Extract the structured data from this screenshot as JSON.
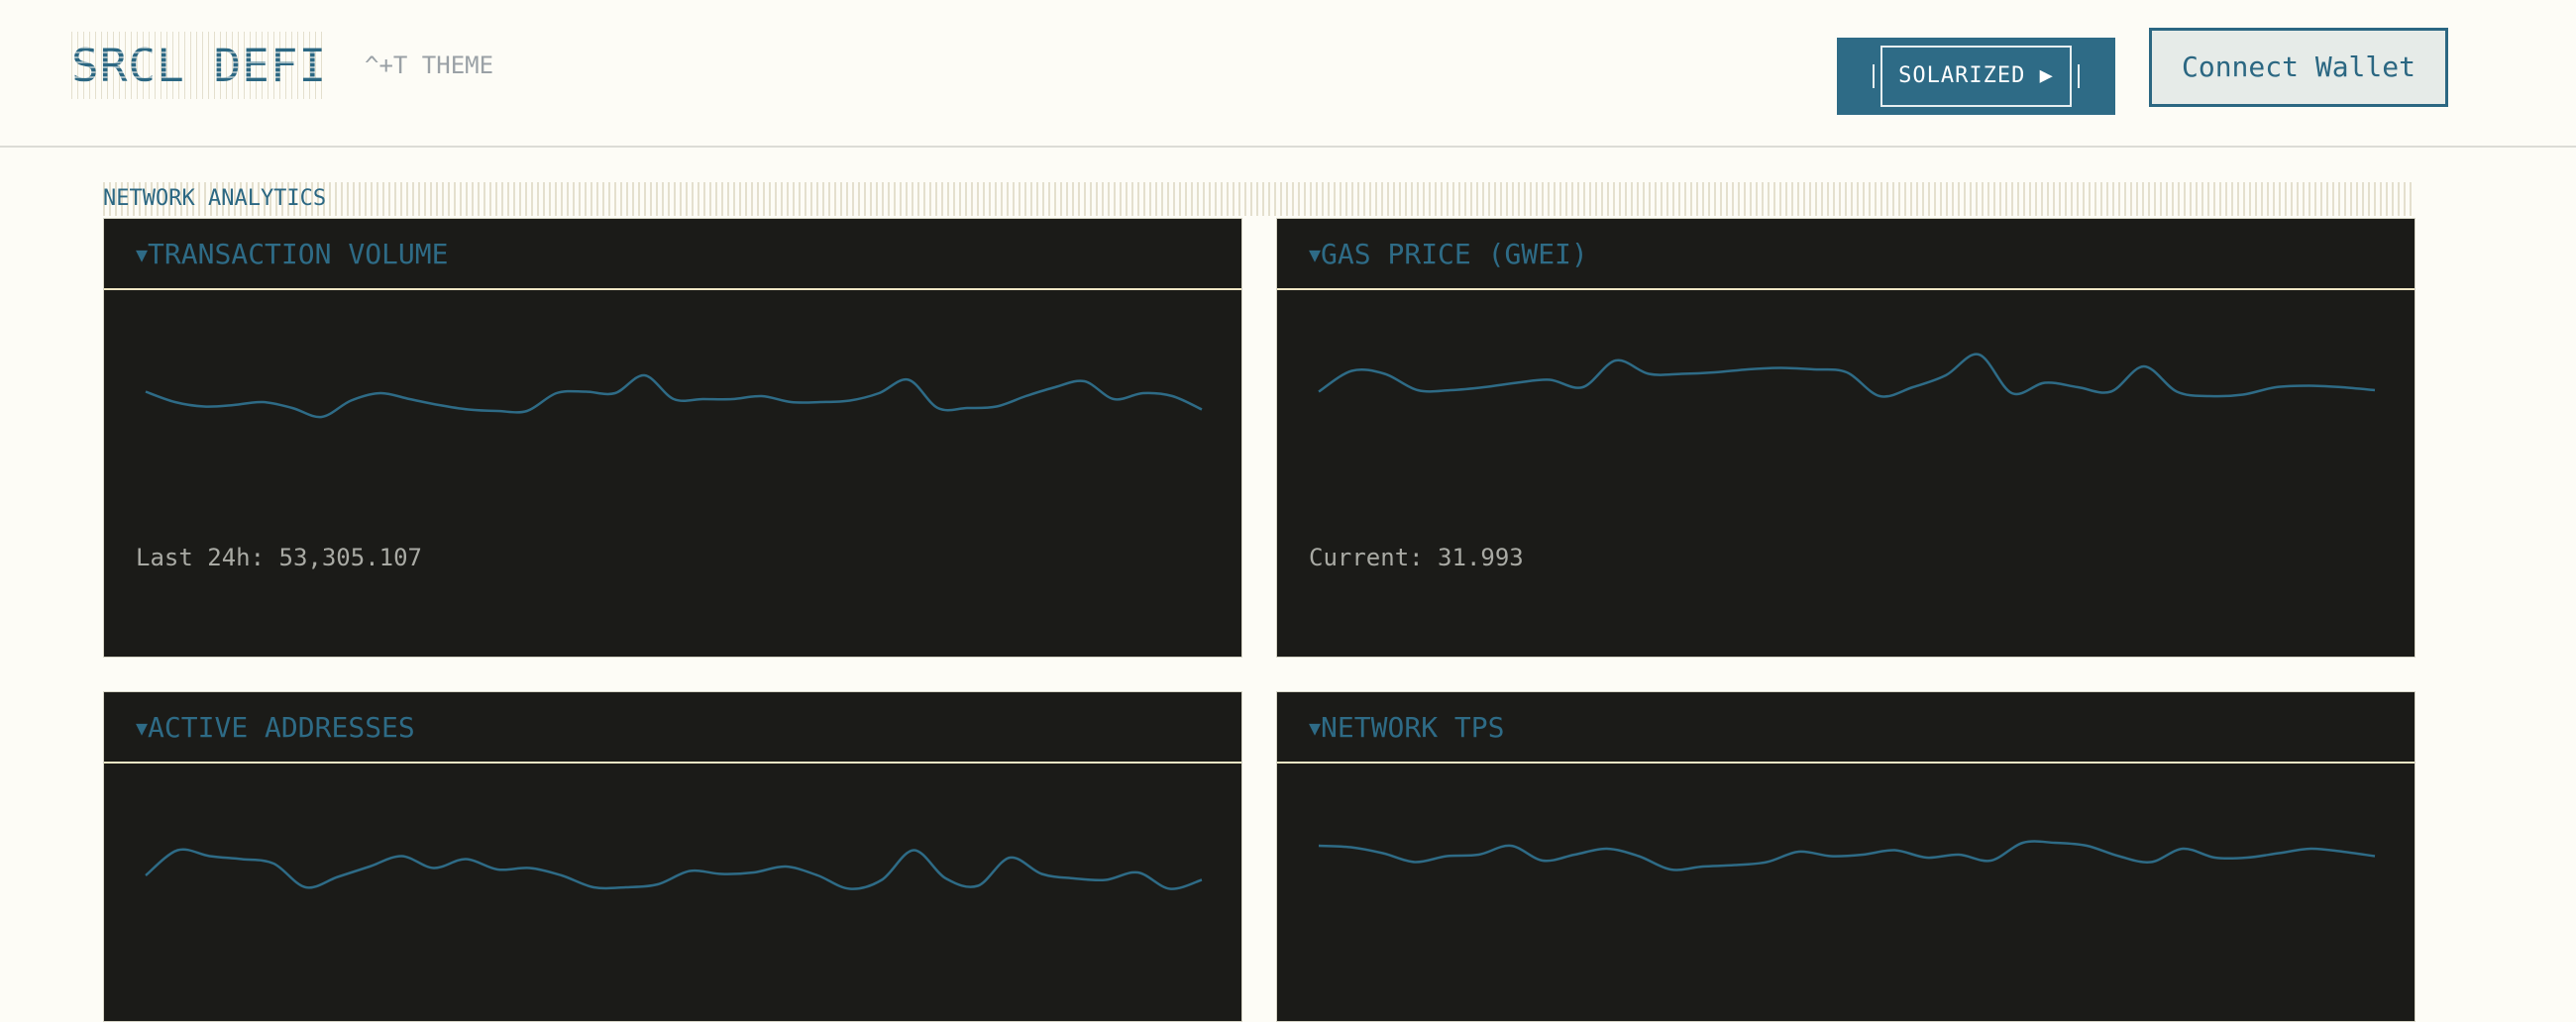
{
  "header": {
    "logo": "SRCL DEFI",
    "theme_hint": "^+T THEME",
    "theme_button": "SOLARIZED ▶",
    "wallet_button": "Connect Wallet"
  },
  "section": {
    "title": "NETWORK ANALYTICS"
  },
  "colors": {
    "background": "#fdfcf6",
    "accent": "#2e6b86",
    "panel_background": "#1b1b18",
    "line": "#2e6b86"
  },
  "panels": [
    {
      "title": "TRANSACTION VOLUME",
      "stat": "Last 24h: 53,305.107",
      "series": [
        55,
        62,
        65,
        64,
        62,
        66,
        72,
        61,
        56,
        60,
        64,
        67,
        68,
        68,
        56,
        55,
        56,
        44,
        60,
        60,
        60,
        58,
        62,
        62,
        61,
        56,
        47,
        66,
        66,
        65,
        58,
        52,
        48,
        60,
        56,
        58,
        67
      ]
    },
    {
      "title": "GAS PRICE (GWEI)",
      "stat": "Current: 31.993",
      "series": [
        55,
        41,
        43,
        54,
        54,
        52,
        49,
        47,
        52,
        34,
        43,
        43,
        42,
        40,
        39,
        40,
        42,
        58,
        52,
        44,
        30,
        56,
        49,
        52,
        55,
        38,
        55,
        58,
        57,
        52,
        51,
        52,
        54
      ]
    },
    {
      "title": "ACTIVE ADDRESSES",
      "stat": "",
      "series": [
        62,
        45,
        49,
        51,
        54,
        70,
        63,
        56,
        49,
        57,
        51,
        58,
        57,
        62,
        70,
        70,
        68,
        59,
        61,
        60,
        56,
        62,
        71,
        65,
        45,
        64,
        69,
        50,
        61,
        64,
        65,
        60,
        71,
        65
      ]
    },
    {
      "title": "NETWORK TPS",
      "stat": "",
      "series": [
        42,
        43,
        47,
        53,
        49,
        48,
        42,
        52,
        48,
        44,
        49,
        58,
        56,
        55,
        53,
        46,
        49,
        48,
        45,
        50,
        48,
        52,
        40,
        40,
        42,
        49,
        53,
        44,
        50,
        50,
        47,
        44,
        46,
        49
      ]
    }
  ]
}
